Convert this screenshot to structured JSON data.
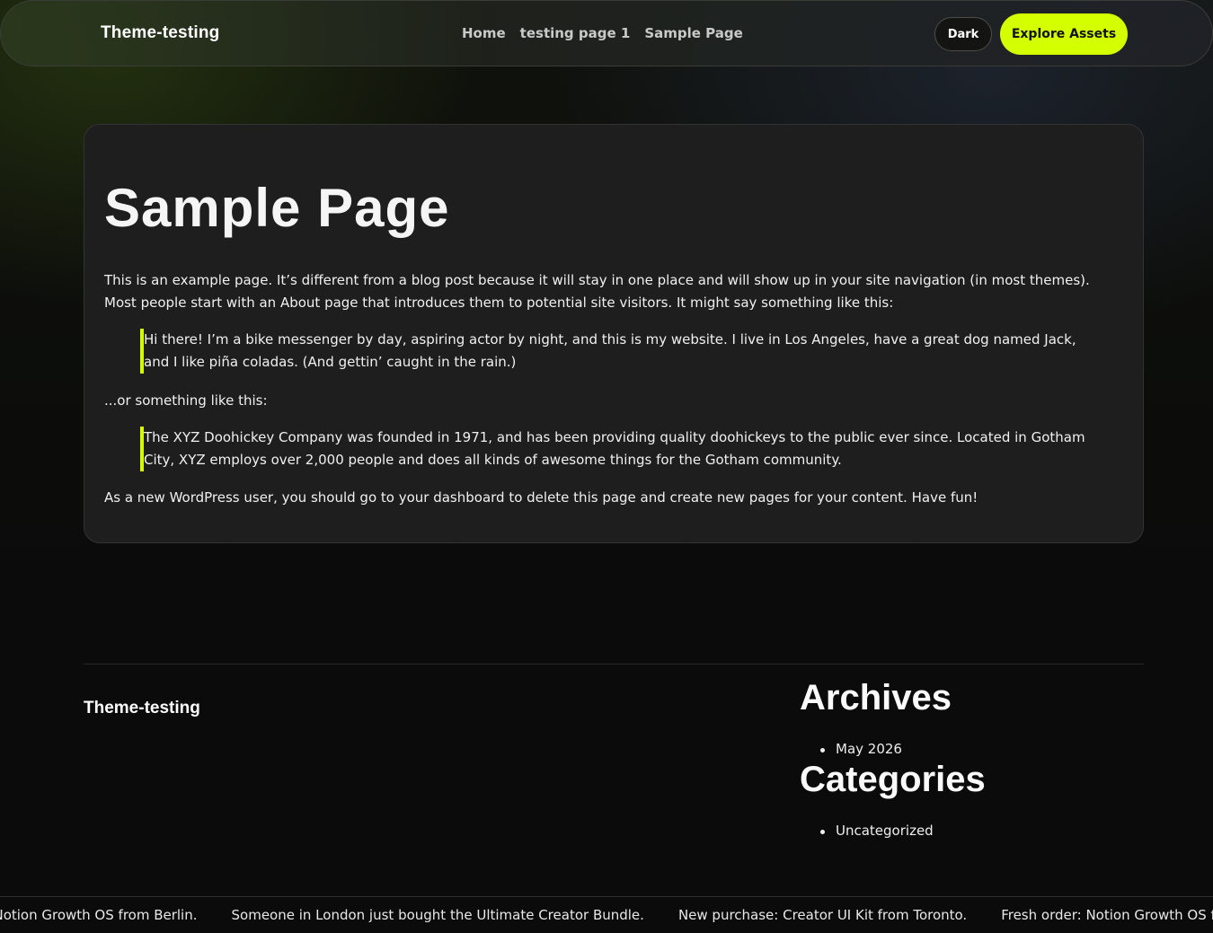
{
  "header": {
    "brand": "Theme-testing",
    "nav": [
      "Home",
      "testing page 1",
      "Sample Page"
    ],
    "dark_label": "Dark",
    "explore_label": "Explore Assets"
  },
  "main": {
    "title": "Sample Page",
    "intro": "This is an example page. It’s different from a blog post because it will stay in one place and will show up in your site navigation (in most themes). Most people start with an About page that introduces them to potential site visitors. It might say something like this:",
    "quote1": "Hi there! I’m a bike messenger by day, aspiring actor by night, and this is my website. I live in Los Angeles, have a great dog named Jack, and I like piña coladas. (And gettin’ caught in the rain.)",
    "middle": "...or something like this:",
    "quote2": "The XYZ Doohickey Company was founded in 1971, and has been providing quality doohickeys to the public ever since. Located in Gotham City, XYZ employs over 2,000 people and does all kinds of awesome things for the Gotham community.",
    "outro": "As a new WordPress user, you should go to your dashboard to delete this page and create new pages for your content. Have fun!"
  },
  "footer": {
    "brand": "Theme-testing",
    "archives_title": "Archives",
    "archives": [
      "May 2026"
    ],
    "categories_title": "Categories",
    "categories": [
      "Uncategorized"
    ]
  },
  "ticker": [
    "der: Notion Growth OS from Berlin.",
    "Someone in London just bought the Ultimate Creator Bundle.",
    "New purchase: Creator UI Kit from Toronto.",
    "Fresh order: Notion Growth OS from"
  ],
  "colors": {
    "accent": "#d4ff00",
    "card_bg": "#1e1e1e",
    "page_bg": "#0b0b0b"
  }
}
